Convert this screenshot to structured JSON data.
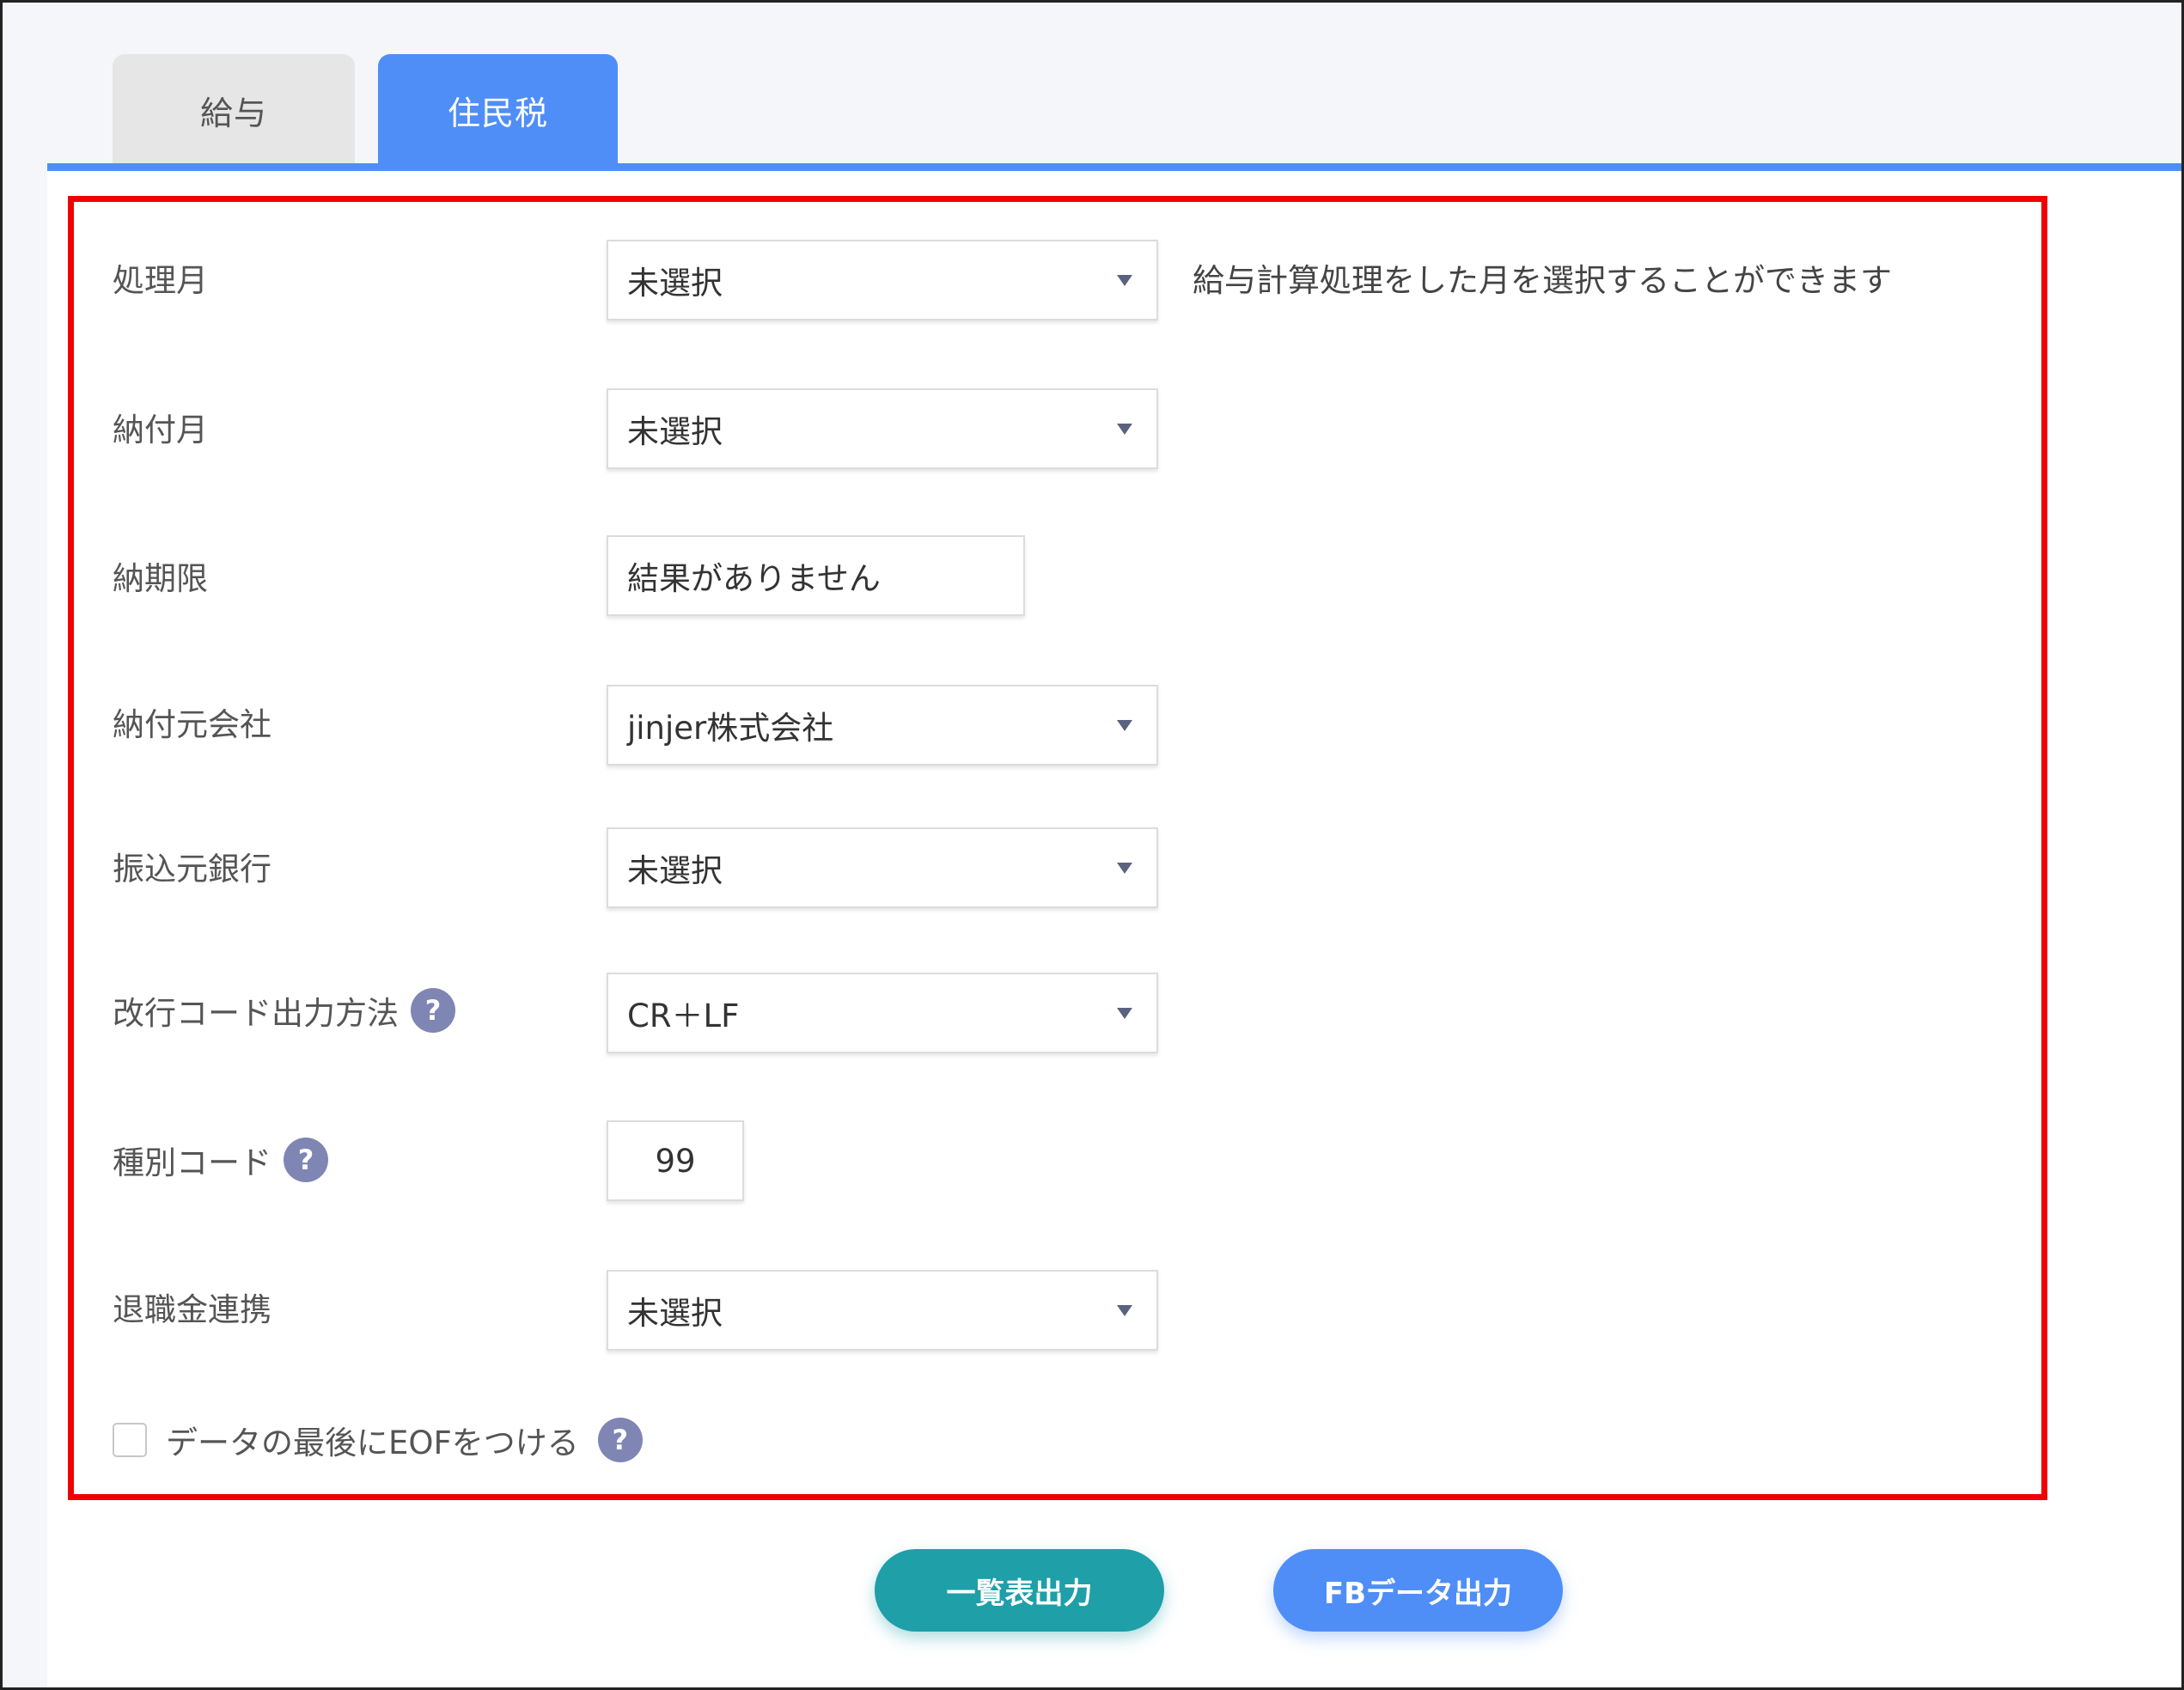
{
  "tabs": [
    {
      "label": "給与"
    },
    {
      "label": "住民税"
    }
  ],
  "form": {
    "processing_month": {
      "label": "処理月",
      "value": "未選択",
      "hint": "給与計算処理をした月を選択することができます"
    },
    "payment_month": {
      "label": "納付月",
      "value": "未選択"
    },
    "payment_deadline": {
      "label": "納期限",
      "value": "結果がありません"
    },
    "payer_company": {
      "label": "納付元会社",
      "value": "jinjer株式会社"
    },
    "source_bank": {
      "label": "振込元銀行",
      "value": "未選択"
    },
    "newline_code": {
      "label": "改行コード出力方法",
      "value": "CR＋LF"
    },
    "type_code": {
      "label": "種別コード",
      "value": "99"
    },
    "retirement_link": {
      "label": "退職金連携",
      "value": "未選択"
    },
    "eof_checkbox": {
      "label": "データの最後にEOFをつける",
      "checked": false
    }
  },
  "help_icon_text": "?",
  "buttons": {
    "list_output": "一覧表出力",
    "fb_output": "FBデータ出力"
  },
  "colors": {
    "accent": "#4f8ef7",
    "teal": "#1f9fa8",
    "highlight": "#f00000",
    "help_icon": "#7f86b4"
  }
}
